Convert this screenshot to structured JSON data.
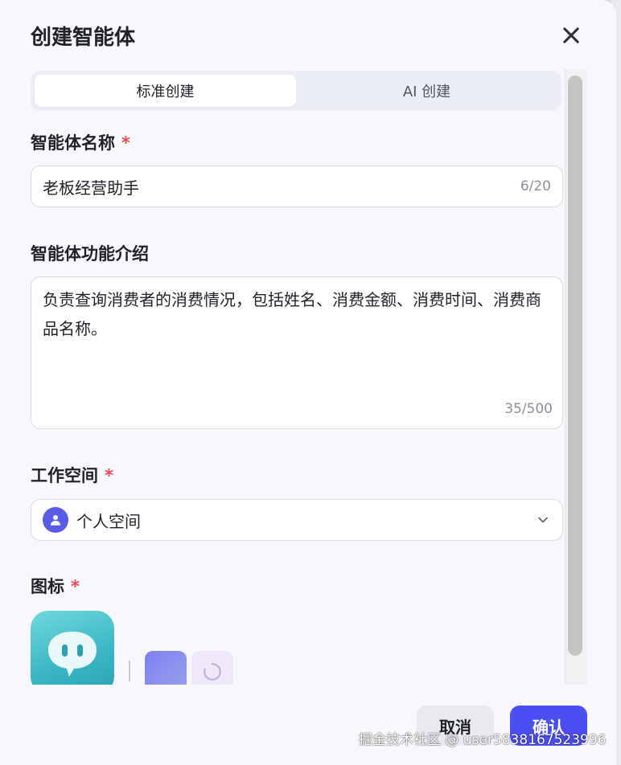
{
  "dialog": {
    "title": "创建智能体"
  },
  "tabs": [
    {
      "label": "标准创建",
      "active": true
    },
    {
      "label": "AI 创建",
      "active": false
    }
  ],
  "fields": {
    "name": {
      "label": "智能体名称",
      "required_mark": "*",
      "value": "老板经营助手",
      "counter": "6/20"
    },
    "description": {
      "label": "智能体功能介绍",
      "value": "负责查询消费者的消费情况，包括姓名、消费金额、消费时间、消费商品名称。",
      "counter": "35/500"
    },
    "workspace": {
      "label": "工作空间",
      "required_mark": "*",
      "value": "个人空间",
      "icon": "user-icon"
    },
    "icon": {
      "label": "图标",
      "required_mark": "*"
    }
  },
  "footer": {
    "cancel_label": "取消",
    "confirm_label": "确认"
  },
  "watermark": "掘金技术社区 @ user5838167523996",
  "colors": {
    "primary": "#4b4ef0",
    "required": "#e34d4d",
    "avatar": "#5b5ce6",
    "icon_teal": "#39b6c4"
  }
}
